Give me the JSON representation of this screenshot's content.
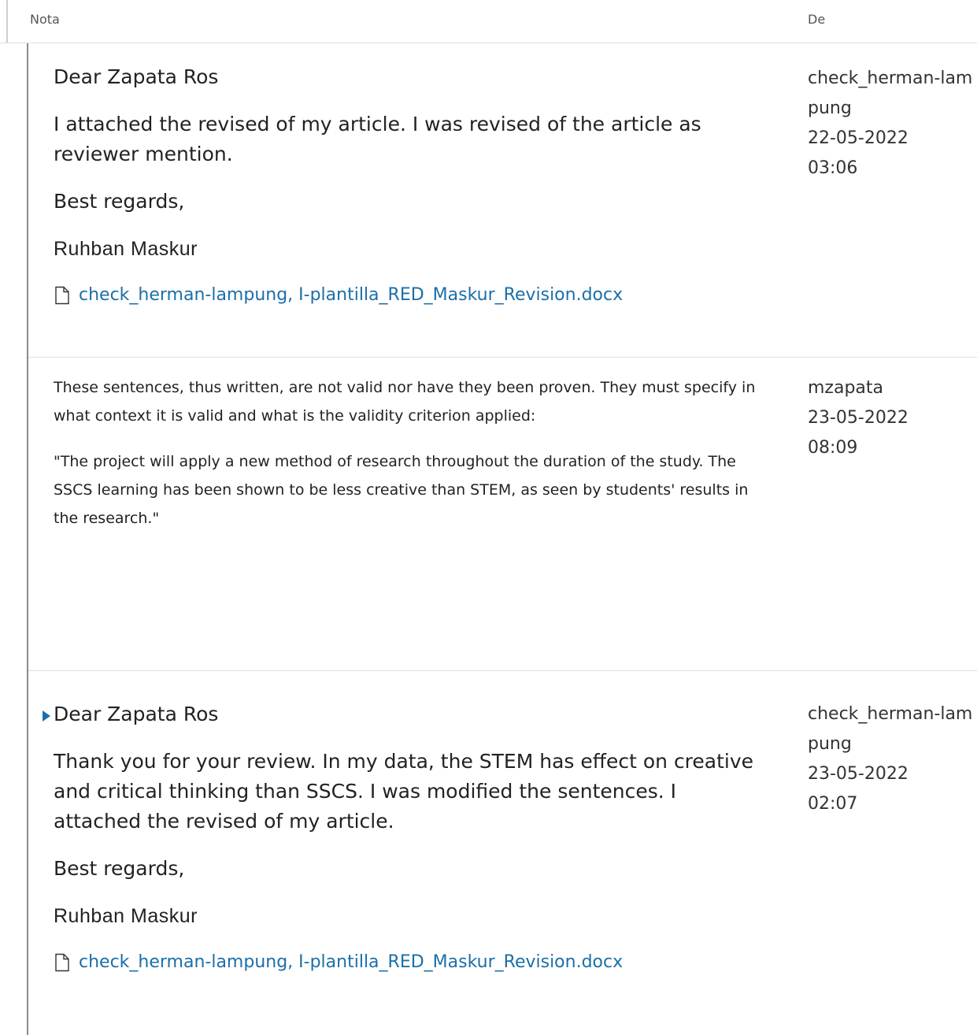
{
  "header": {
    "note_col": "Nota",
    "from_col": "De"
  },
  "notes": [
    {
      "paragraphs": [
        "Dear Zapata Ros",
        "I attached the revised of my article. I was revised of the article as reviewer mention.",
        "Best regards,",
        "Ruhban Maskur"
      ],
      "attachment": "check_herman-lampung, I-plantilla_RED_Maskur_Revision.docx",
      "author": "check_herman-lampung",
      "date": "22-05-2022",
      "time": "03:06"
    },
    {
      "paragraphs": [
        "These sentences, thus written, are not valid nor have they been proven. They must specify in what context it is valid and what is the validity criterion applied:",
        "\"The project will apply a new method of research throughout the duration of the study. The SSCS learning has been shown to be less creative than STEM, as seen by students' results in the research.\""
      ],
      "author": "mzapata",
      "date": "23-05-2022",
      "time": "08:09"
    },
    {
      "paragraphs": [
        "Dear Zapata Ros",
        "Thank you for your review. In my data, the STEM has effect on creative and critical thinking than SSCS. I was modified the sentences. I attached the revised of my article.",
        "Best regards,",
        "Ruhban Maskur"
      ],
      "attachment": "check_herman-lampung, I-plantilla_RED_Maskur_Revision.docx",
      "author": "check_herman-lampung",
      "date": "23-05-2022",
      "time": "02:07"
    }
  ],
  "colors": {
    "link": "#1b6fa8",
    "divider": "#dddddd"
  },
  "icons": {
    "attachment": "file-icon",
    "expand": "caret-right-icon"
  }
}
